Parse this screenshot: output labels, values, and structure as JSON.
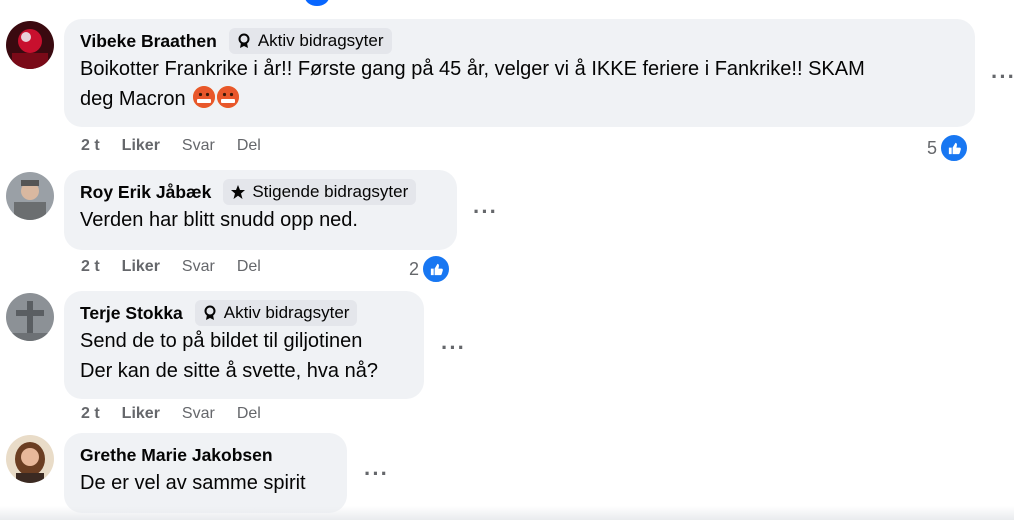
{
  "comments": [
    {
      "author": "Vibeke Braathen",
      "badge": "Aktiv bidragsyter",
      "text_line1": "Boikotter Frankrike i år!! Første gang på 45 år, velger vi å IKKE feriere i Fankrike!! SKAM",
      "text_line2": "deg Macron",
      "time": "2 t",
      "like": "Liker",
      "reply": "Svar",
      "share": "Del",
      "reactions": "5"
    },
    {
      "author": "Roy Erik Jåbæk",
      "badge": "Stigende bidragsyter",
      "text_line1": "Verden har blitt snudd opp ned.",
      "time": "2 t",
      "like": "Liker",
      "reply": "Svar",
      "share": "Del",
      "reactions": "2"
    },
    {
      "author": "Terje Stokka",
      "badge": "Aktiv bidragsyter",
      "text_line1": "Send de to på bildet til giljotinen",
      "text_line2": "Der kan de sitte å svette, hva nå?",
      "time": "2 t",
      "like": "Liker",
      "reply": "Svar",
      "share": "Del"
    },
    {
      "author": "Grethe Marie Jakobsen",
      "text_line1": "De er vel av samme spirit"
    }
  ],
  "more_label": "···",
  "icons": {
    "badge_active": "rosette-icon",
    "badge_rising": "star-icon",
    "like": "thumbs-up-icon",
    "emoji": "angry-face-emoji"
  },
  "colors": {
    "accent": "#1877f2",
    "bubble": "#f0f2f5",
    "meta": "#65676b"
  }
}
